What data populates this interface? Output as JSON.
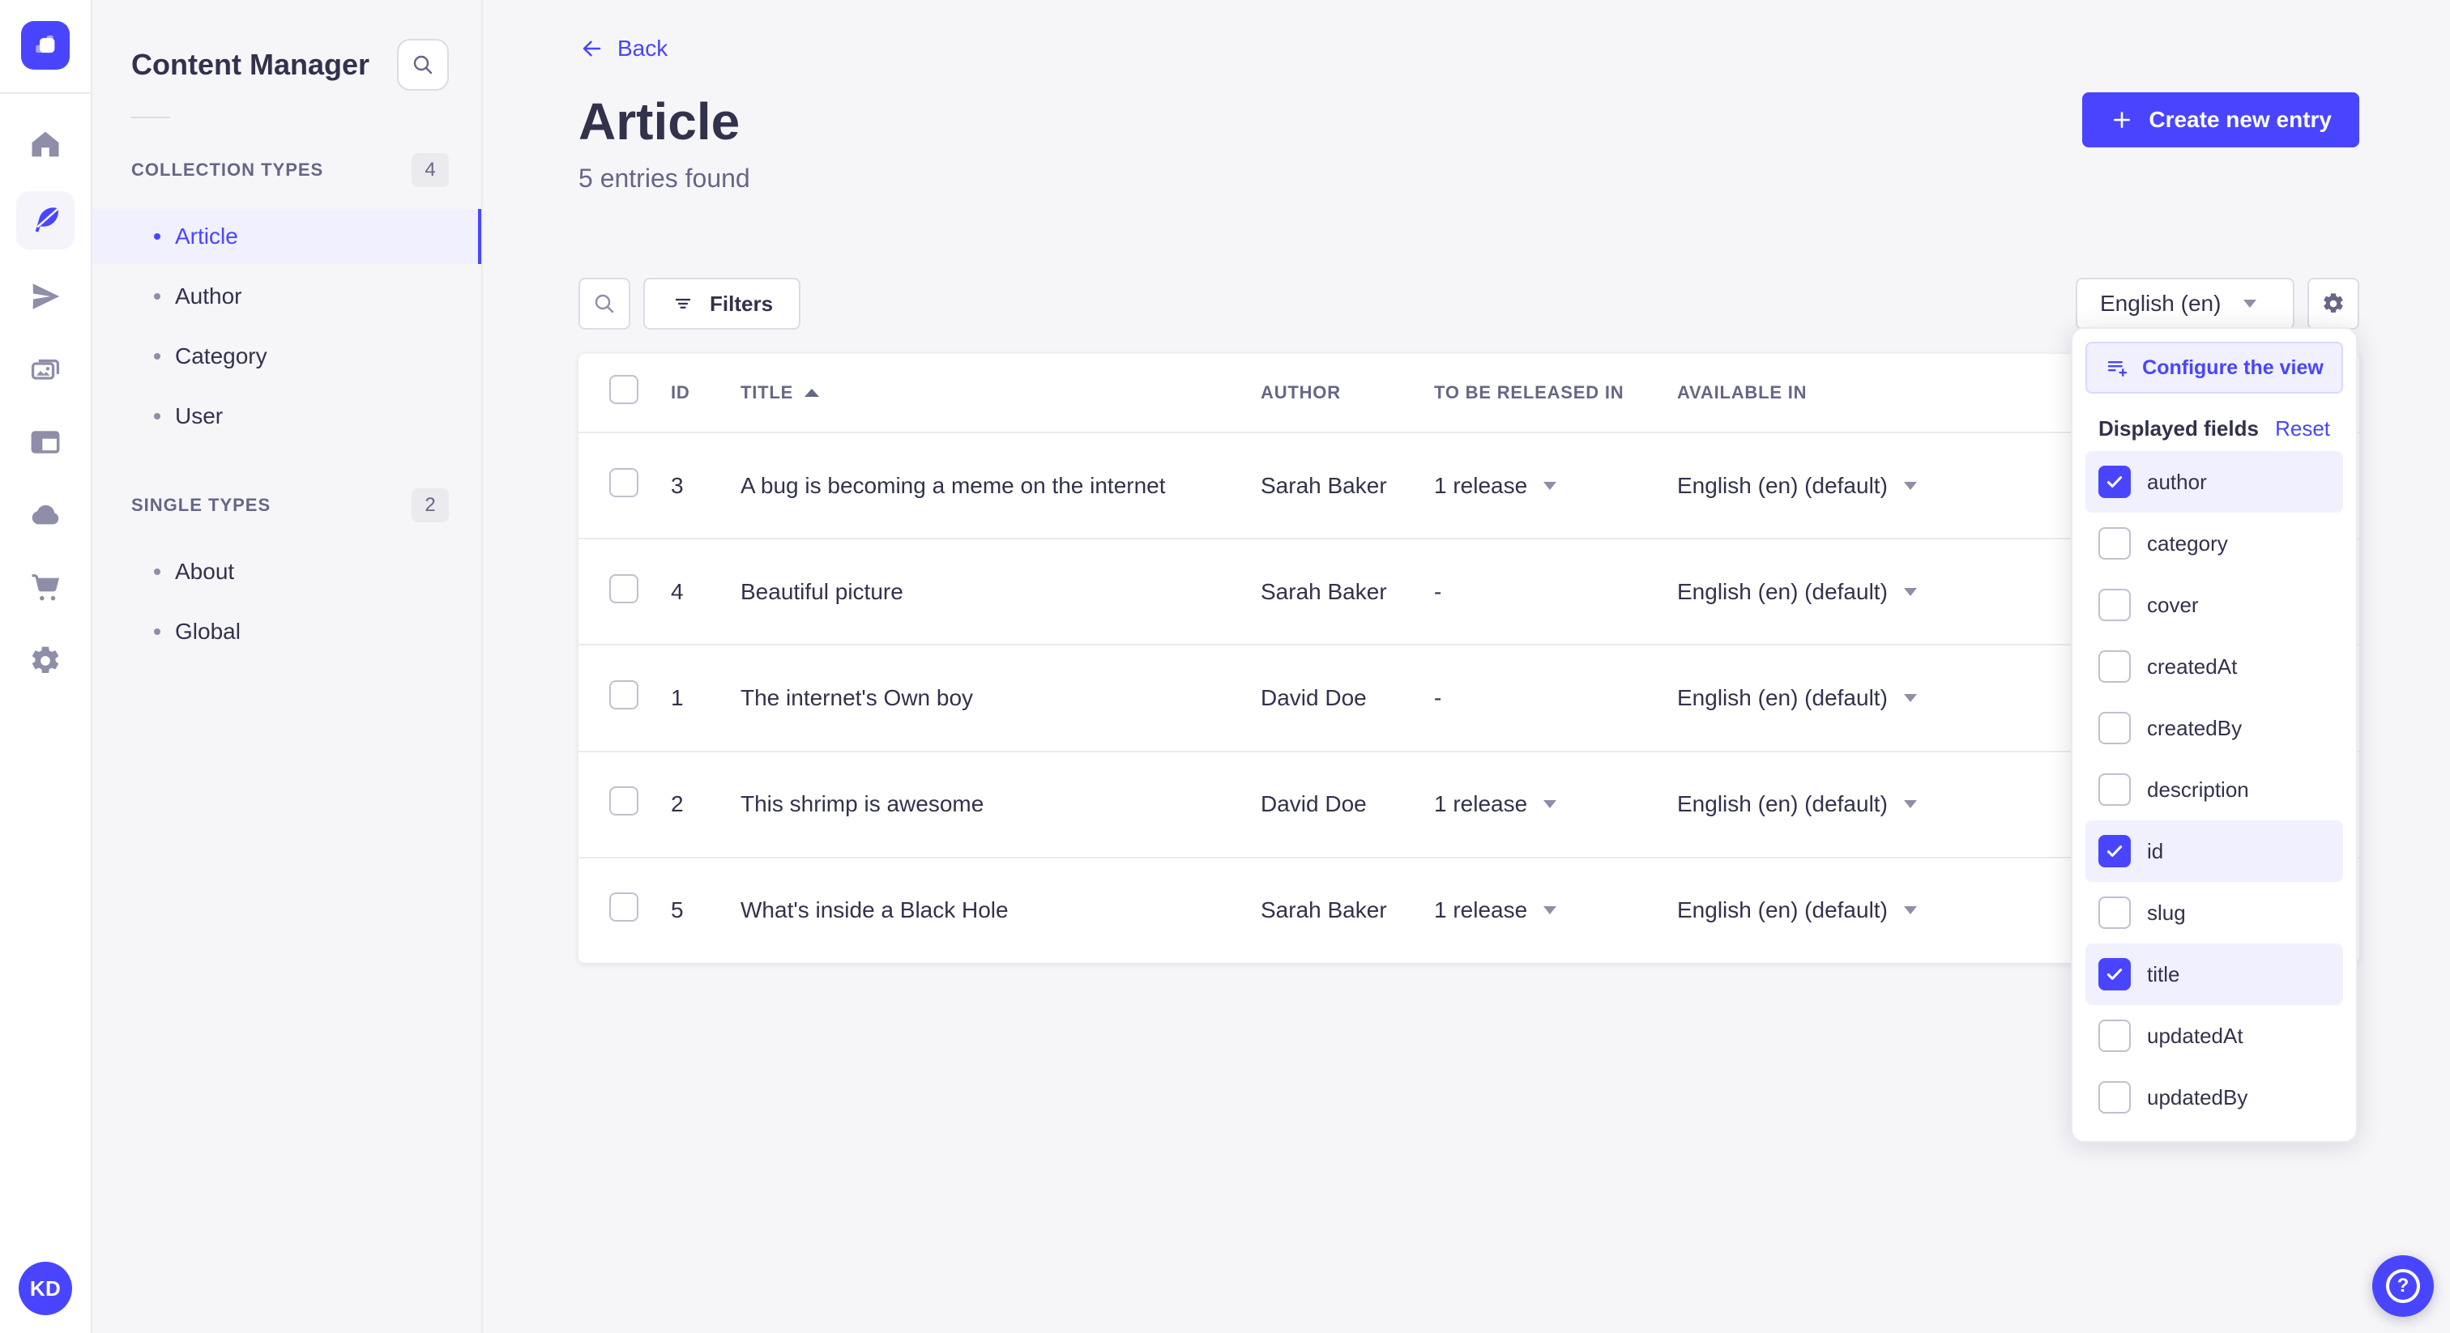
{
  "subnav": {
    "title": "Content Manager",
    "sections": [
      {
        "label": "COLLECTION TYPES",
        "badge": "4",
        "items": [
          {
            "label": "Article",
            "active": true
          },
          {
            "label": "Author",
            "active": false
          },
          {
            "label": "Category",
            "active": false
          },
          {
            "label": "User",
            "active": false
          }
        ]
      },
      {
        "label": "SINGLE TYPES",
        "badge": "2",
        "items": [
          {
            "label": "About",
            "active": false
          },
          {
            "label": "Global",
            "active": false
          }
        ]
      }
    ]
  },
  "header": {
    "back_label": "Back",
    "title": "Article",
    "subtitle": "5 entries found",
    "create_label": "Create new entry"
  },
  "toolbar": {
    "filters_label": "Filters",
    "locale_value": "English (en)"
  },
  "table": {
    "headers": [
      "ID",
      "TITLE",
      "AUTHOR",
      "TO BE RELEASED IN",
      "AVAILABLE IN"
    ],
    "sorted_by": "TITLE",
    "sort_direction": "asc",
    "rows": [
      {
        "id": "3",
        "title": "A bug is becoming a meme on the internet",
        "author": "Sarah Baker",
        "released": "1 release",
        "released_caret": true,
        "available": "English (en) (default)"
      },
      {
        "id": "4",
        "title": "Beautiful picture",
        "author": "Sarah Baker",
        "released": "-",
        "released_caret": false,
        "available": "English (en) (default)"
      },
      {
        "id": "1",
        "title": "The internet's Own boy",
        "author": "David Doe",
        "released": "-",
        "released_caret": false,
        "available": "English (en) (default)"
      },
      {
        "id": "2",
        "title": "This shrimp is awesome",
        "author": "David Doe",
        "released": "1 release",
        "released_caret": true,
        "available": "English (en) (default)"
      },
      {
        "id": "5",
        "title": "What's inside a Black Hole",
        "author": "Sarah Baker",
        "released": "1 release",
        "released_caret": true,
        "available": "English (en) (default)"
      }
    ]
  },
  "popover": {
    "configure_label": "Configure the view",
    "fields_label": "Displayed fields",
    "reset_label": "Reset",
    "fields": [
      {
        "label": "author",
        "checked": true
      },
      {
        "label": "category",
        "checked": false
      },
      {
        "label": "cover",
        "checked": false
      },
      {
        "label": "createdAt",
        "checked": false
      },
      {
        "label": "createdBy",
        "checked": false
      },
      {
        "label": "description",
        "checked": false
      },
      {
        "label": "id",
        "checked": true
      },
      {
        "label": "slug",
        "checked": false
      },
      {
        "label": "title",
        "checked": true
      },
      {
        "label": "updatedAt",
        "checked": false
      },
      {
        "label": "updatedBy",
        "checked": false
      }
    ]
  },
  "rail_icons": [
    "strapi-logo-icon",
    "home-icon",
    "feather-icon",
    "paper-plane-icon",
    "media-icon",
    "layout-icon",
    "cloud-icon",
    "cart-icon",
    "gear-icon"
  ],
  "user": {
    "initials": "KD"
  },
  "colors": {
    "primary": "#4945ff",
    "primary_light": "#f0f0ff",
    "text": "#32324d",
    "text_secondary": "#666687",
    "border": "#eaeaef",
    "background": "#f6f6f9"
  }
}
